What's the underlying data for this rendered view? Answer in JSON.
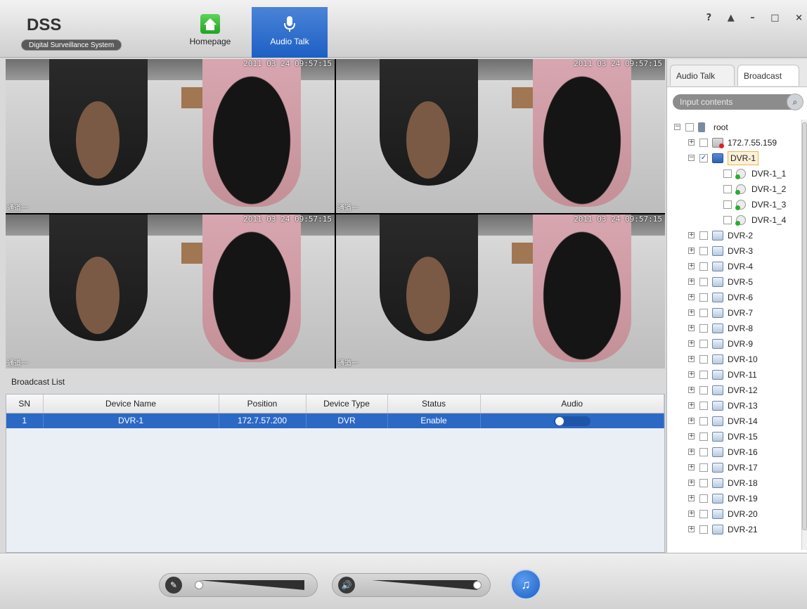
{
  "app": {
    "logo": "DSS",
    "subtitle": "Digital Surveillance System",
    "tabs": [
      {
        "label": "Homepage",
        "icon": "home-icon",
        "active": false
      },
      {
        "label": "Audio Talk",
        "icon": "microphone-icon",
        "active": true
      }
    ],
    "window_controls": [
      "?",
      "▲",
      "–",
      "□",
      "×"
    ]
  },
  "video": {
    "cells": [
      {
        "timestamp": "2011 03 24 09:57:15",
        "channel": "通道一"
      },
      {
        "timestamp": "2011 03 24 09:57:15",
        "channel": "通道一"
      },
      {
        "timestamp": "2011 03 24 09:57:15",
        "channel": "通道一"
      },
      {
        "timestamp": "2011 03 24 09:57:15",
        "channel": "通道一"
      }
    ]
  },
  "broadcast_list": {
    "title": "Broadcast List",
    "columns": [
      "SN",
      "Device Name",
      "Position",
      "Device Type",
      "Status",
      "Audio"
    ],
    "rows": [
      {
        "sn": "1",
        "device_name": "DVR-1",
        "position": "172.7.57.200",
        "device_type": "DVR",
        "status": "Enable",
        "audio_on": true
      }
    ]
  },
  "right_panel": {
    "tabs": [
      {
        "label": "Audio Talk",
        "active": false
      },
      {
        "label": "Broadcast",
        "active": true
      }
    ],
    "search": {
      "placeholder": "Input contents"
    },
    "tree": [
      {
        "label": "root",
        "level": 0,
        "expander": "minus",
        "checked": false,
        "icon": "root-icon"
      },
      {
        "label": "172.7.55.159",
        "level": 1,
        "expander": "plus",
        "checked": false,
        "icon": "device-offline-icon"
      },
      {
        "label": "DVR-1",
        "level": 1,
        "expander": "minus",
        "checked": true,
        "icon": "device-active-icon",
        "selected": true
      },
      {
        "label": "DVR-1_1",
        "level": 2,
        "expander": "",
        "checked": false,
        "icon": "camera-icon"
      },
      {
        "label": "DVR-1_2",
        "level": 2,
        "expander": "",
        "checked": false,
        "icon": "camera-icon"
      },
      {
        "label": "DVR-1_3",
        "level": 2,
        "expander": "",
        "checked": false,
        "icon": "camera-icon"
      },
      {
        "label": "DVR-1_4",
        "level": 2,
        "expander": "",
        "checked": false,
        "icon": "camera-icon"
      },
      {
        "label": "DVR-2",
        "level": 1,
        "expander": "plus",
        "checked": false,
        "icon": "device-icon"
      },
      {
        "label": "DVR-3",
        "level": 1,
        "expander": "plus",
        "checked": false,
        "icon": "device-icon"
      },
      {
        "label": "DVR-4",
        "level": 1,
        "expander": "plus",
        "checked": false,
        "icon": "device-icon"
      },
      {
        "label": "DVR-5",
        "level": 1,
        "expander": "plus",
        "checked": false,
        "icon": "device-icon"
      },
      {
        "label": "DVR-6",
        "level": 1,
        "expander": "plus",
        "checked": false,
        "icon": "device-icon"
      },
      {
        "label": "DVR-7",
        "level": 1,
        "expander": "plus",
        "checked": false,
        "icon": "device-icon"
      },
      {
        "label": "DVR-8",
        "level": 1,
        "expander": "plus",
        "checked": false,
        "icon": "device-icon"
      },
      {
        "label": "DVR-9",
        "level": 1,
        "expander": "plus",
        "checked": false,
        "icon": "device-icon"
      },
      {
        "label": "DVR-10",
        "level": 1,
        "expander": "plus",
        "checked": false,
        "icon": "device-icon"
      },
      {
        "label": "DVR-11",
        "level": 1,
        "expander": "plus",
        "checked": false,
        "icon": "device-icon"
      },
      {
        "label": "DVR-12",
        "level": 1,
        "expander": "plus",
        "checked": false,
        "icon": "device-icon"
      },
      {
        "label": "DVR-13",
        "level": 1,
        "expander": "plus",
        "checked": false,
        "icon": "device-icon"
      },
      {
        "label": "DVR-14",
        "level": 1,
        "expander": "plus",
        "checked": false,
        "icon": "device-icon"
      },
      {
        "label": "DVR-15",
        "level": 1,
        "expander": "plus",
        "checked": false,
        "icon": "device-icon"
      },
      {
        "label": "DVR-16",
        "level": 1,
        "expander": "plus",
        "checked": false,
        "icon": "device-icon"
      },
      {
        "label": "DVR-17",
        "level": 1,
        "expander": "plus",
        "checked": false,
        "icon": "device-icon"
      },
      {
        "label": "DVR-18",
        "level": 1,
        "expander": "plus",
        "checked": false,
        "icon": "device-icon"
      },
      {
        "label": "DVR-19",
        "level": 1,
        "expander": "plus",
        "checked": false,
        "icon": "device-icon"
      },
      {
        "label": "DVR-20",
        "level": 1,
        "expander": "plus",
        "checked": false,
        "icon": "device-icon"
      },
      {
        "label": "DVR-21",
        "level": 1,
        "expander": "plus",
        "checked": false,
        "icon": "device-icon"
      }
    ]
  },
  "controls": {
    "mic_volume": 0.0,
    "speaker_volume": 1.0,
    "talk_button_icon": "talk-icon"
  },
  "colors": {
    "accent": "#2c69c5",
    "active_tab": "#1d5fc4"
  }
}
